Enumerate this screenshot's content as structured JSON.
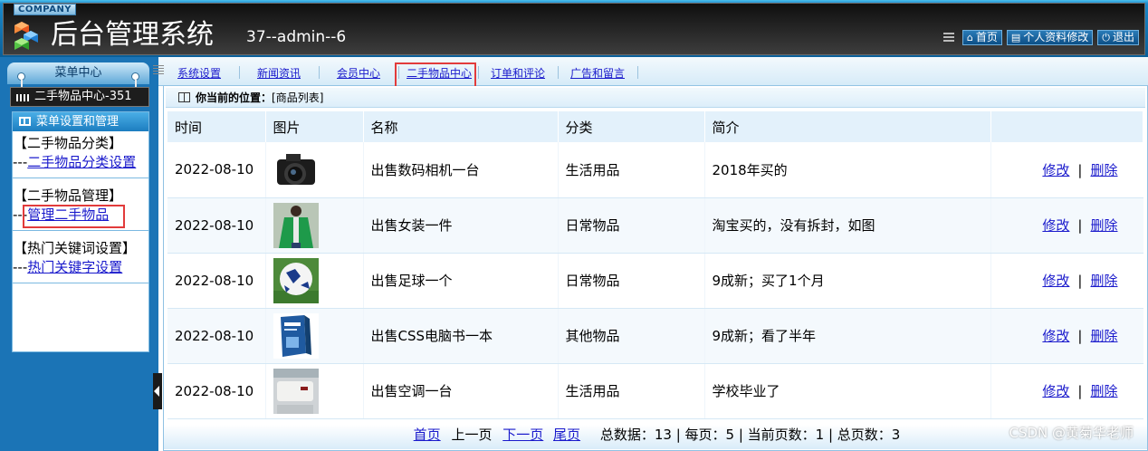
{
  "header": {
    "company": "COMPANY",
    "title": "后台管理系统",
    "user_info": "37--admin--6",
    "buttons": [
      {
        "label": "首页",
        "icon": "home-icon"
      },
      {
        "label": "个人资料修改",
        "icon": "profile-icon"
      },
      {
        "label": "退出",
        "icon": "power-icon"
      }
    ]
  },
  "sidebar": {
    "menu_title": "菜单中心",
    "module": "二手物品中心-351",
    "panel_title": "菜单设置和管理",
    "groups": [
      {
        "title": "【二手物品分类】",
        "prefix": "---",
        "link": "二手物品分类设置"
      },
      {
        "title": "【二手物品管理】",
        "prefix": "---",
        "link": "管理二手物品"
      },
      {
        "title": "【热门关键词设置】",
        "prefix": "---",
        "link": "热门关键字设置"
      }
    ]
  },
  "nav": {
    "tabs": [
      "系统设置",
      "新闻资讯",
      "会员中心",
      "二手物品中心",
      "订单和评论",
      "广告和留言"
    ],
    "active": "二手物品中心"
  },
  "breadcrumb": {
    "label": "你当前的位置：",
    "value": "[商品列表]"
  },
  "table": {
    "columns": [
      "时间",
      "图片",
      "名称",
      "分类",
      "简介",
      ""
    ],
    "rows": [
      {
        "time": "2022-08-10",
        "image": "camera",
        "name": "出售数码相机一台",
        "category": "生活用品",
        "intro": "2018年买的",
        "edit": "修改",
        "delete": "删除"
      },
      {
        "time": "2022-08-10",
        "image": "green-jacket",
        "name": "出售女装一件",
        "category": "日常物品",
        "intro": "淘宝买的，没有拆封，如图",
        "edit": "修改",
        "delete": "删除"
      },
      {
        "time": "2022-08-10",
        "image": "football",
        "name": "出售足球一个",
        "category": "日常物品",
        "intro": "9成新；买了1个月",
        "edit": "修改",
        "delete": "删除"
      },
      {
        "time": "2022-08-10",
        "image": "css-book",
        "name": "出售CSS电脑书一本",
        "category": "其他物品",
        "intro": "9成新；看了半年",
        "edit": "修改",
        "delete": "删除"
      },
      {
        "time": "2022-08-10",
        "image": "air-conditioner",
        "name": "出售空调一台",
        "category": "生活用品",
        "intro": "学校毕业了",
        "edit": "修改",
        "delete": "删除"
      }
    ],
    "separator": "|"
  },
  "pager": {
    "first": "首页",
    "prev": "上一页",
    "next": "下一页",
    "last": "尾页",
    "summary": "总数据：13 | 每页：5 | 当前页数：1 | 总页数：3"
  },
  "watermark": "CSDN @黄菊华老师",
  "colors": {
    "accent": "#1b74b6",
    "highlight_box": "#e23b3b",
    "link": "#1a1acc"
  }
}
